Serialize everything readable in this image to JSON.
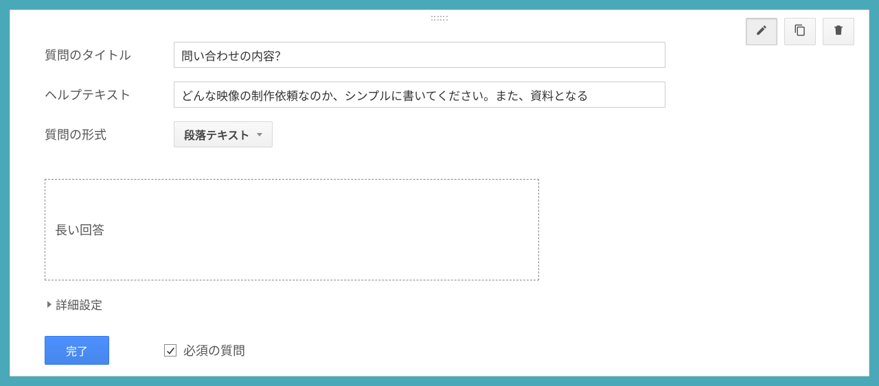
{
  "labels": {
    "title": "質問のタイトル",
    "help": "ヘルプテキスト",
    "format": "質問の形式",
    "advanced": "詳細設定",
    "required": "必須の質問",
    "answer_placeholder": "長い回答"
  },
  "values": {
    "title": "問い合わせの内容？",
    "help": "どんな映像の制作依頼なのか、シンプルに書いてください。また、資料となる",
    "format_selected": "段落テキスト"
  },
  "buttons": {
    "done": "完了"
  },
  "toolbar": {
    "edit": "edit-icon",
    "copy": "copy-icon",
    "delete": "trash-icon"
  },
  "state": {
    "required_checked": true
  }
}
